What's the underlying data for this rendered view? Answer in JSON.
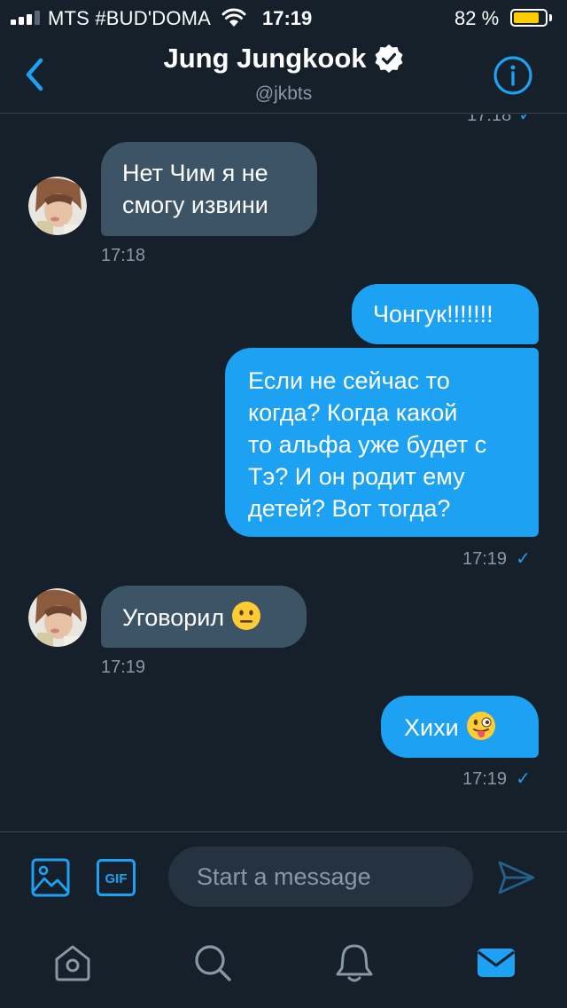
{
  "status_bar": {
    "carrier": "MTS #BUD'DOMA",
    "time": "17:19",
    "battery_percent": "82 %",
    "battery_level": 0.82
  },
  "header": {
    "name": "Jung Jungkook",
    "handle": "@jkbts",
    "verified": true
  },
  "thread": {
    "clipped_time": "17:18",
    "messages": [
      {
        "direction": "in",
        "text_lines": [
          "Нет Чим я не",
          "смогу извини"
        ],
        "time": "17:18"
      },
      {
        "direction": "out",
        "text_lines": [
          "Чонгук!!!!!!!"
        ]
      },
      {
        "direction": "out",
        "text_lines": [
          "Если не сейчас то",
          "когда? Когда какой",
          "то альфа уже будет с",
          "Тэ? И он родит ему",
          "детей? Вот тогда?"
        ],
        "time": "17:19"
      },
      {
        "direction": "in",
        "text": "Уговорил",
        "emoji": "neutral-face-emoji",
        "time": "17:19"
      },
      {
        "direction": "out",
        "text": "Хихи",
        "emoji": "winking-face-with-tongue-emoji",
        "time": "17:19"
      }
    ]
  },
  "composer": {
    "placeholder": "Start a message"
  },
  "tabbar": {
    "items": [
      "home-icon",
      "search-icon",
      "notifications-icon",
      "messages-icon"
    ],
    "active": "messages-icon"
  },
  "colors": {
    "background": "#15202b",
    "accent": "#1da1f2",
    "incoming_bubble": "#3d5466",
    "secondary_text": "#8899a6",
    "battery": "#ffcc00"
  }
}
